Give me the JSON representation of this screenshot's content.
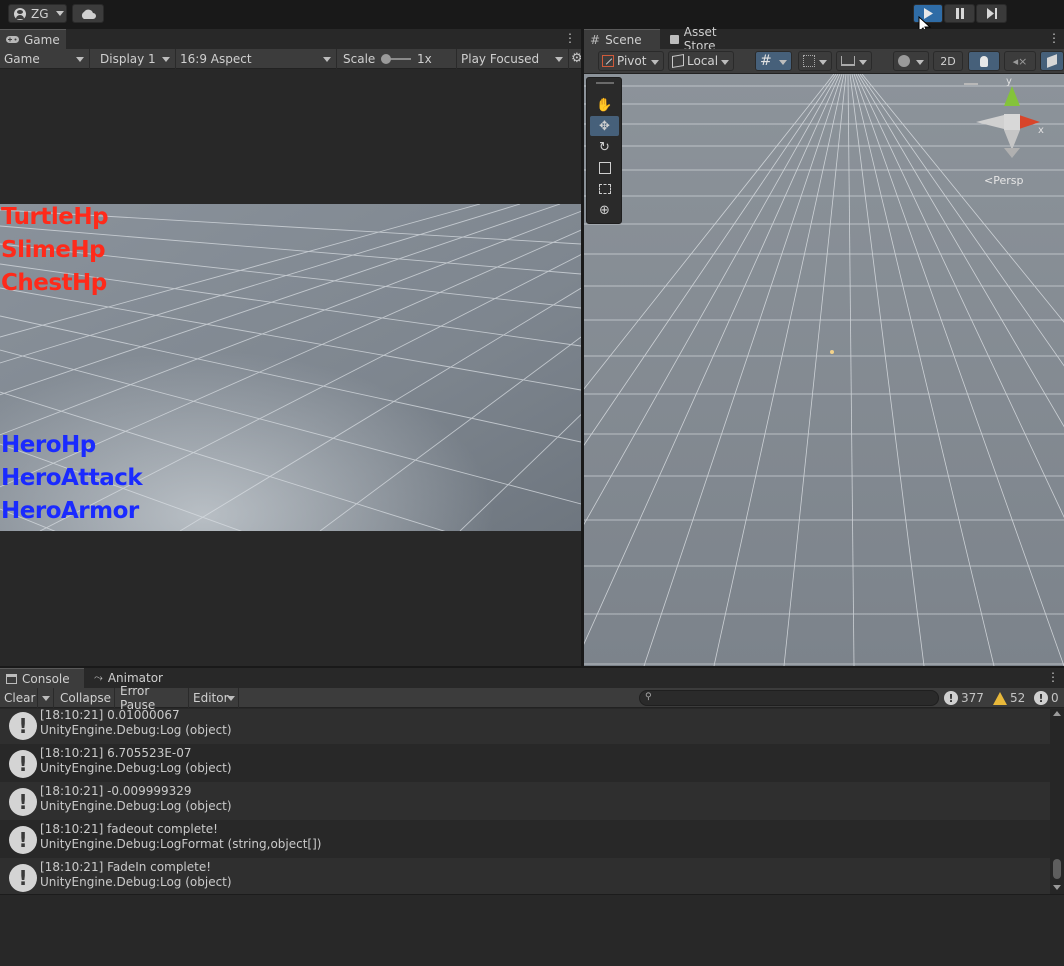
{
  "topbar": {
    "account_label": "ZG",
    "play_icon": "play-icon",
    "pause_icon": "pause-icon",
    "step_icon": "step-icon"
  },
  "game_panel": {
    "tab_label": "Game",
    "toolbar": {
      "mode": "Game",
      "display": "Display 1",
      "aspect": "16:9 Aspect",
      "scale_label": "Scale",
      "scale_value": "1x",
      "play_mode": "Play Focused"
    },
    "hud": {
      "enemy_labels": [
        "TurtleHp",
        "SlimeHp",
        "ChestHp"
      ],
      "hero_labels": [
        "HeroHp",
        "HeroAttack",
        "HeroArmor"
      ],
      "enemy_color": "#ff2a1a",
      "hero_color": "#1a2aff"
    }
  },
  "scene_panel": {
    "tabs": [
      "Scene",
      "Asset Store"
    ],
    "toolbar": {
      "pivot": "Pivot",
      "space": "Local",
      "twod": "2D"
    },
    "gizmo": {
      "y": "y",
      "x": "x",
      "projection": "<Persp"
    }
  },
  "console_panel": {
    "tabs": [
      "Console",
      "Animator"
    ],
    "toolbar": {
      "clear": "Clear",
      "collapse": "Collapse",
      "error_pause": "Error Pause",
      "editor": "Editor",
      "search_placeholder": "",
      "log_count": "377",
      "warn_count": "52",
      "error_count": "0"
    },
    "entries": [
      {
        "line1": "[18:10:21] 0.01000067",
        "line2": "UnityEngine.Debug:Log (object)"
      },
      {
        "line1": "[18:10:21] 6.705523E-07",
        "line2": "UnityEngine.Debug:Log (object)"
      },
      {
        "line1": "[18:10:21] -0.009999329",
        "line2": "UnityEngine.Debug:Log (object)"
      },
      {
        "line1": "[18:10:21] fadeout complete!",
        "line2": "UnityEngine.Debug:LogFormat (string,object[])"
      },
      {
        "line1": "[18:10:21] FadeIn complete!",
        "line2": "UnityEngine.Debug:Log (object)"
      }
    ]
  }
}
